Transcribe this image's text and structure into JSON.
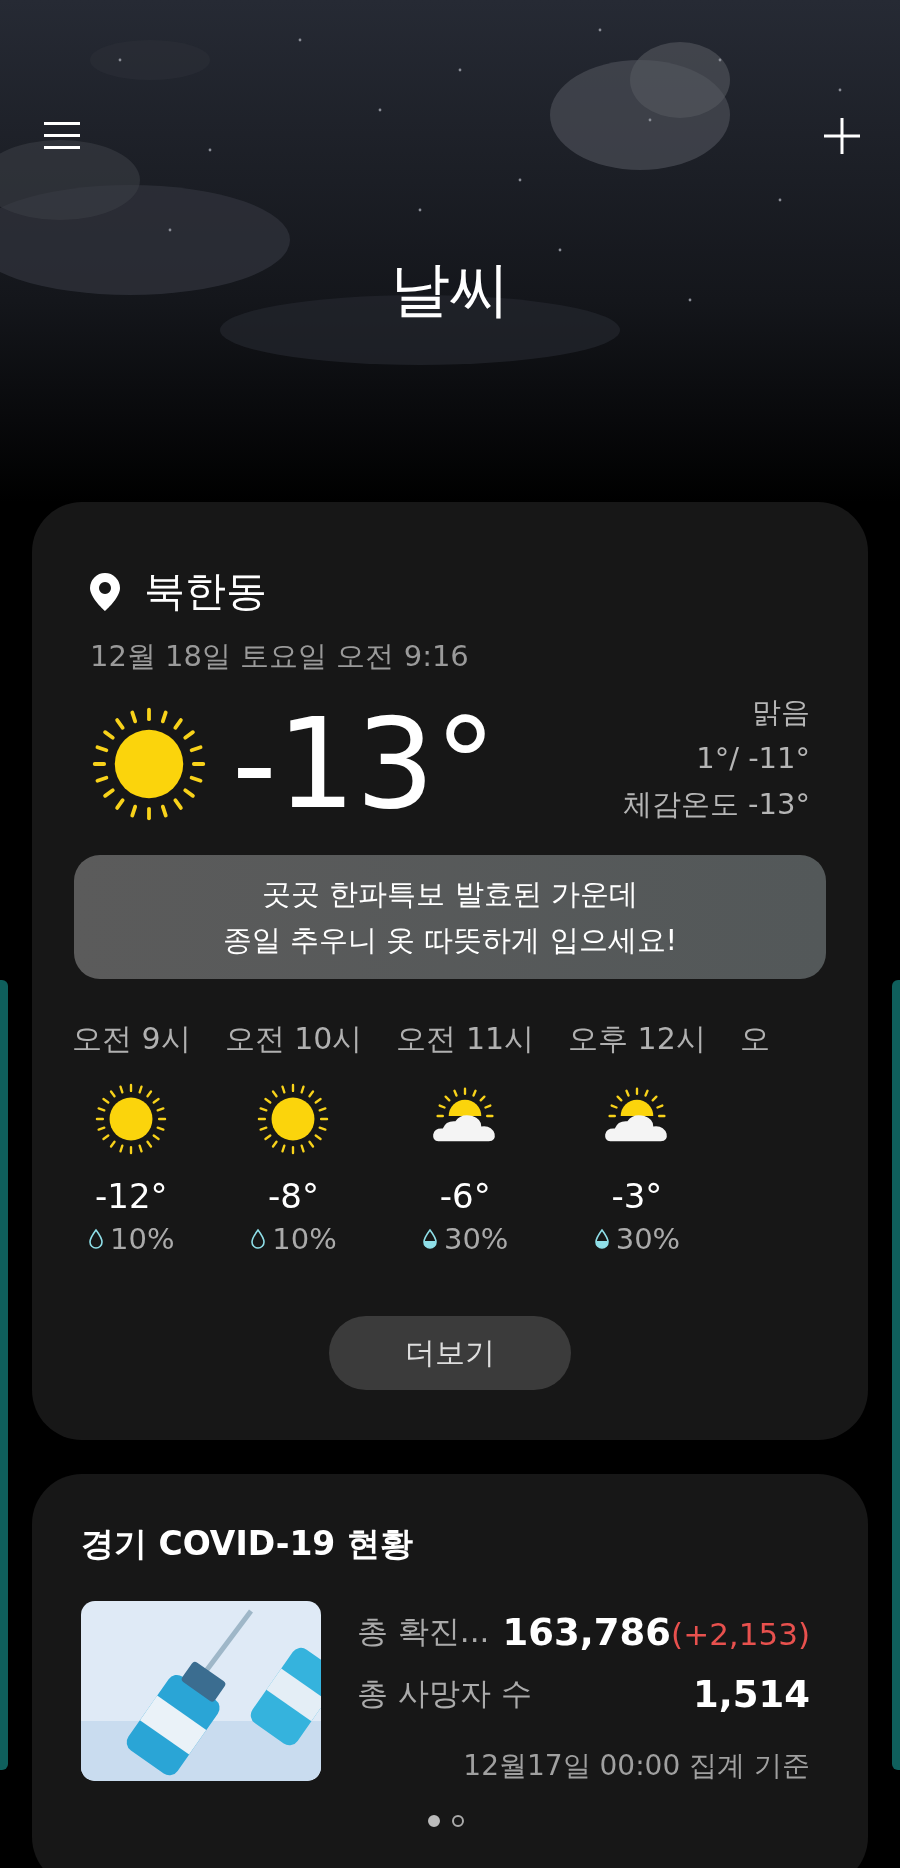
{
  "header": {
    "title": "날씨"
  },
  "weather_card": {
    "location": "북한동",
    "datetime": "12월 18일 토요일 오전 9:16",
    "kind": "sunny",
    "temperature": "-13°",
    "condition": "맑음",
    "high_low": "1°/ -11°",
    "feels_like": "체감온도 -13°",
    "alert": "곳곳 한파특보 발효된 가운데\n종일 추우니 옷 따뜻하게 입으세요!",
    "hourly": [
      {
        "time": "오전 9시",
        "kind": "sunny",
        "temp": "-12°",
        "precip": "10%"
      },
      {
        "time": "오전 10시",
        "kind": "sunny",
        "temp": "-8°",
        "precip": "10%"
      },
      {
        "time": "오전 11시",
        "kind": "partly_cloudy",
        "temp": "-6°",
        "precip": "30%"
      },
      {
        "time": "오후 12시",
        "kind": "partly_cloudy",
        "temp": "-3°",
        "precip": "30%"
      },
      {
        "time": "오"
      }
    ],
    "more_button": "더보기"
  },
  "covid_card": {
    "title": "경기 COVID-19 현황",
    "rows": [
      {
        "label": "총 확진...",
        "value": "163,786",
        "change": "(+2,153)"
      },
      {
        "label": "총 사망자 수",
        "value": "1,514"
      }
    ],
    "updated": "12월17일 00:00 집계 기준",
    "pages": [
      {
        "selected": true
      },
      {
        "selected": false
      }
    ]
  }
}
